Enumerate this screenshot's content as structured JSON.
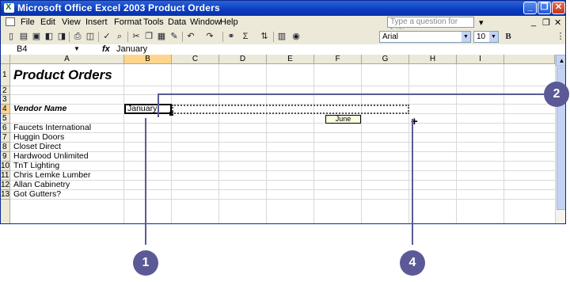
{
  "window": {
    "title": "Microsoft Office Excel 2003 Product Orders",
    "controls": {
      "minimize": "_",
      "restore": "❐",
      "close": "✕"
    }
  },
  "menubar": {
    "items": [
      "File",
      "Edit",
      "View",
      "Insert",
      "Format",
      "Tools",
      "Data",
      "Window",
      "Help"
    ],
    "help_placeholder": "Type a question for help",
    "doc_controls": {
      "minimize": "_",
      "restore": "❐",
      "close": "✕"
    }
  },
  "toolbar": {
    "font": "Arial",
    "font_size": "10",
    "bold_label": "B",
    "sum_label": "Σ"
  },
  "formula_bar": {
    "name_box": "B4",
    "fx_label": "fx",
    "value": "January"
  },
  "sheet": {
    "columns": [
      "A",
      "B",
      "C",
      "D",
      "E",
      "F",
      "G",
      "H",
      "I"
    ],
    "rows": [
      "1",
      "2",
      "3",
      "4",
      "5",
      "6",
      "7",
      "8",
      "9",
      "10",
      "11",
      "12",
      "13"
    ],
    "title": "Product Orders",
    "vendor_header": "Vendor Name",
    "b4": "January",
    "autofill_tip": "June",
    "vendors": [
      "Faucets International",
      "Huggin Doors",
      "Closet Direct",
      "Hardwood Unlimited",
      "TnT Lighting",
      "Chris Lemke Lumber",
      "Allan Cabinetry",
      "Got Gutters?"
    ]
  },
  "callouts": {
    "one": "1",
    "two": "2",
    "four": "4"
  },
  "colors": {
    "callout": "#5b5a96",
    "titlebar": "#0a3cc0",
    "selected_header": "#ffd58d"
  },
  "icons": [
    "excel-app-icon",
    "new-icon",
    "open-icon",
    "save-icon",
    "permission-icon",
    "print-icon",
    "print-preview-icon",
    "spelling-icon",
    "research-icon",
    "cut-icon",
    "copy-icon",
    "paste-icon",
    "format-painter-icon",
    "undo-icon",
    "redo-icon",
    "hyperlink-icon",
    "autosum-icon",
    "sort-ascending-icon",
    "chart-wizard-icon",
    "help-icon",
    "fill-handle-cursor-icon"
  ]
}
